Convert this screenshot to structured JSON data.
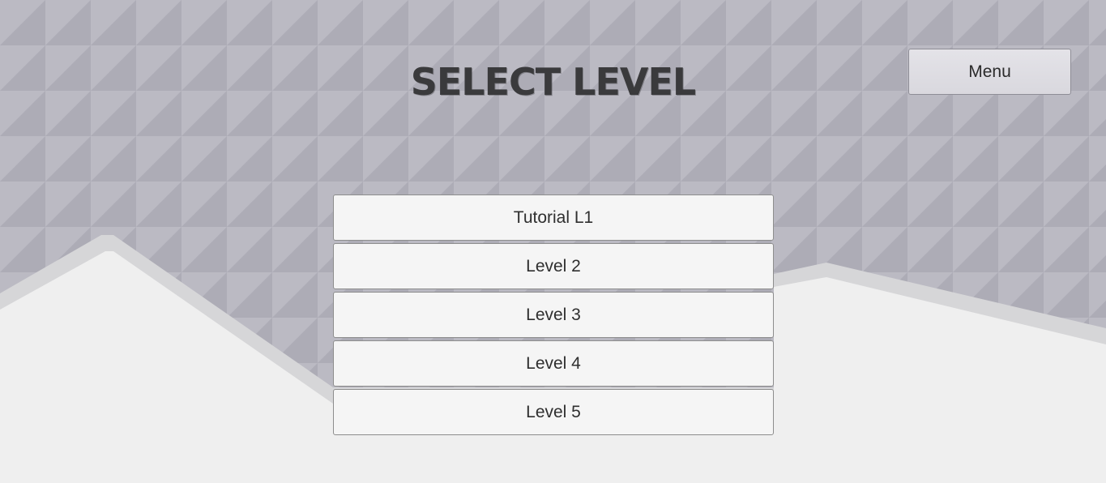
{
  "title": "SELECT LEVEL",
  "menu_button": {
    "label": "Menu"
  },
  "levels": [
    {
      "label": "Tutorial L1"
    },
    {
      "label": "Level 2"
    },
    {
      "label": "Level 3"
    },
    {
      "label": "Level 4"
    },
    {
      "label": "Level 5"
    }
  ],
  "colors": {
    "sky": "#b5b4be",
    "ground": "#efefef",
    "button": "#f5f5f5",
    "title": "#3a3a3c"
  }
}
